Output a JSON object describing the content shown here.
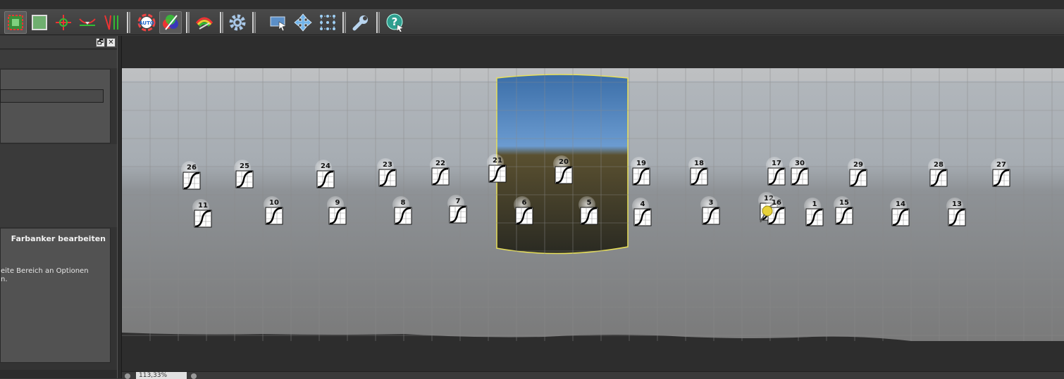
{
  "toolbar": {
    "buttons": [
      {
        "icon": "select-images-icon",
        "active": true
      },
      {
        "icon": "crop-frame-icon"
      },
      {
        "icon": "control-point-crosshair-icon"
      },
      {
        "icon": "horizon-line-icon"
      },
      {
        "icon": "vertical-lines-icon"
      },
      {
        "icon": "auto-color-icon",
        "label": "AUTO"
      },
      {
        "icon": "color-palette-icon",
        "active": true
      },
      {
        "icon": "color-curves-icon"
      },
      {
        "icon": "settings-gear-icon"
      },
      {
        "icon": "move-image-icon"
      },
      {
        "icon": "move-arrows-icon"
      },
      {
        "icon": "control-points-grid-icon"
      },
      {
        "icon": "wrench-icon"
      },
      {
        "icon": "help-icon"
      }
    ]
  },
  "left_panel": {
    "restore_button": "🗗",
    "close_button": "✕",
    "section_title": "Farbanker bearbeiten",
    "help_text_line1": "eite Bereich an Optionen",
    "help_text_line2": "n."
  },
  "status": {
    "zoom_value": "113,33%"
  },
  "colors": {
    "selection_outline": "#e8e05a",
    "panel_background": "#525252",
    "grid_line": "#8a8a8a"
  },
  "anchors": [
    {
      "n": "26"
    },
    {
      "n": "25"
    },
    {
      "n": "24"
    },
    {
      "n": "23"
    },
    {
      "n": "22"
    },
    {
      "n": "21"
    },
    {
      "n": "20"
    },
    {
      "n": "19"
    },
    {
      "n": "18"
    },
    {
      "n": "17"
    },
    {
      "n": "30"
    },
    {
      "n": "29"
    },
    {
      "n": "28"
    },
    {
      "n": "27"
    },
    {
      "n": "11"
    },
    {
      "n": "10"
    },
    {
      "n": "9"
    },
    {
      "n": "8"
    },
    {
      "n": "7"
    },
    {
      "n": "6"
    },
    {
      "n": "5"
    },
    {
      "n": "4"
    },
    {
      "n": "3"
    },
    {
      "n": "12"
    },
    {
      "n": "16"
    },
    {
      "n": "1"
    },
    {
      "n": "15"
    },
    {
      "n": "14"
    },
    {
      "n": "13"
    }
  ]
}
